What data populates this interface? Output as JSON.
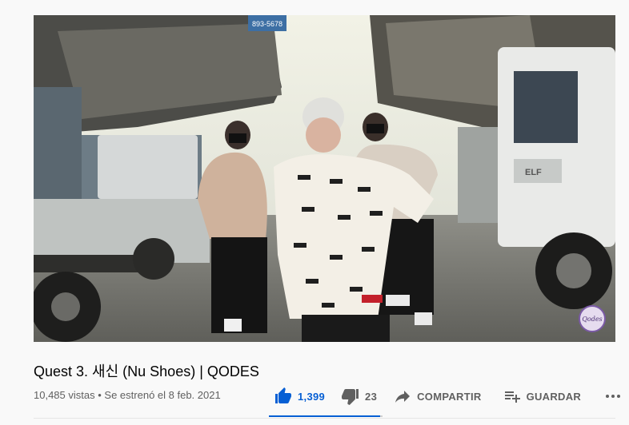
{
  "video": {
    "title": "Quest 3. 새신 (Nu Shoes) | QODES",
    "views": "10,485 vistas",
    "separator": "•",
    "premiere_date": "Se estrenó el 8 feb. 2021",
    "watermark_text": "Qodes"
  },
  "actions": {
    "like_count": "1,399",
    "dislike_count": "23",
    "share_label": "COMPARTIR",
    "save_label": "GUARDAR",
    "like_ratio": 0.98
  },
  "scene": {
    "sign_text": "893-5678",
    "truck_badge": "ELF"
  },
  "colors": {
    "accent": "#065fd4",
    "secondary_text": "#606060",
    "background": "#f9f9f9"
  },
  "icons": {
    "like": "thumb-up-icon",
    "dislike": "thumb-down-icon",
    "share": "share-arrow-icon",
    "save": "playlist-add-icon",
    "more": "more-horizontal-icon"
  }
}
